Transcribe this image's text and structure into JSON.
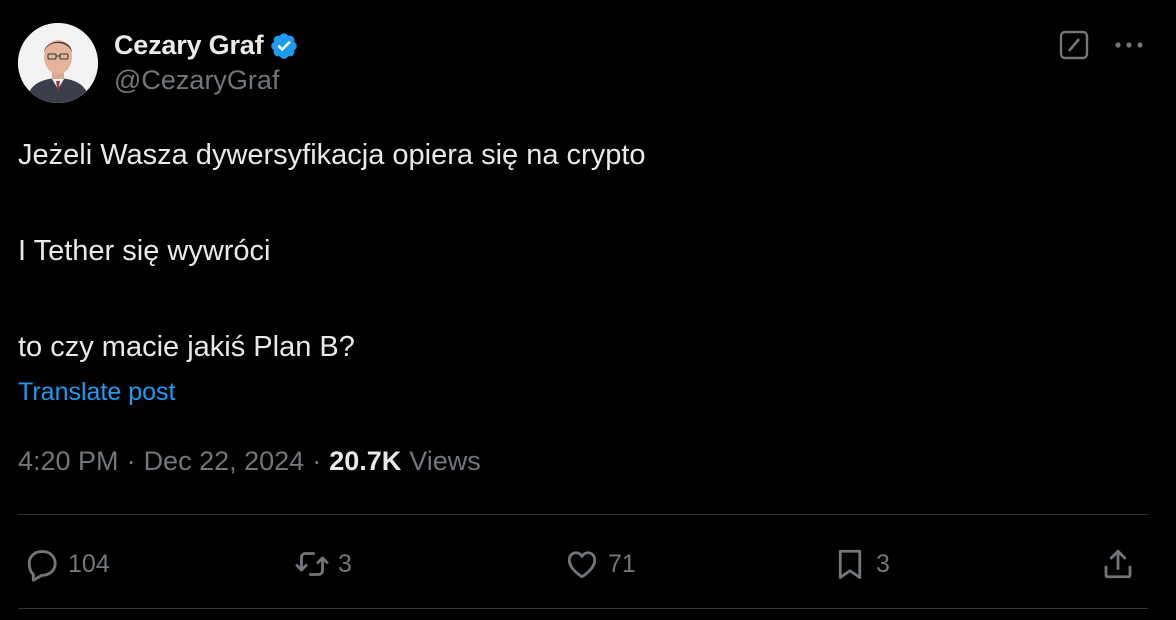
{
  "author": {
    "display_name": "Cezary Graf",
    "handle": "@CezaryGraf",
    "verified": true,
    "verified_icon": "verified-badge-icon",
    "avatar": "avatar"
  },
  "post": {
    "lines": [
      "Jeżeli Wasza dywersyfikacja opiera się na crypto",
      "I Tether się wywróci",
      "to czy macie jakiś Plan B?"
    ],
    "translate_label": "Translate post"
  },
  "meta": {
    "time": "4:20 PM",
    "separator": "·",
    "date": "Dec 22, 2024",
    "views_count": "20.7K",
    "views_label": "Views"
  },
  "actions": {
    "replies": "104",
    "reposts": "3",
    "likes": "71",
    "bookmarks": "3"
  },
  "colors": {
    "background": "#000000",
    "text": "#e7e9ea",
    "muted": "#71767b",
    "link": "#1d9bf0",
    "verified": "#1d9bf0",
    "divider": "#2f3336"
  }
}
